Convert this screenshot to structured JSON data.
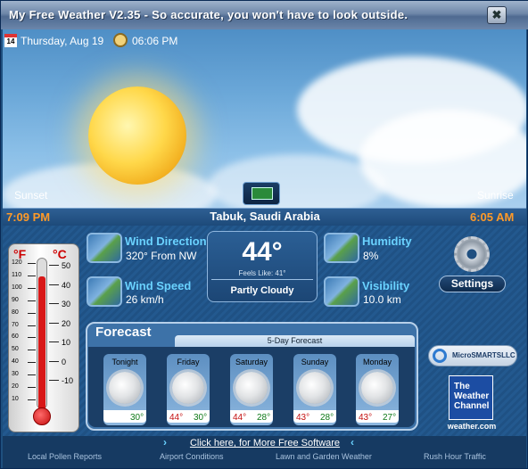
{
  "window": {
    "title": "My Free Weather V2.35 -  So accurate, you won't have to look outside.",
    "close_glyph": "✖"
  },
  "header": {
    "calendar_day": "14",
    "date": "Thursday, Aug 19",
    "time": "06:06 PM",
    "sunset_label": "Sunset",
    "sunrise_label": "Sunrise",
    "sunset_time": "7:09 PM",
    "sunrise_time": "6:05 AM",
    "location": "Tabuk, Saudi Arabia"
  },
  "thermometer": {
    "f_label": "°F",
    "c_label": "°C",
    "f_ticks": [
      "120",
      "110",
      "100",
      "90",
      "80",
      "70",
      "60",
      "50",
      "40",
      "30",
      "20",
      "10"
    ],
    "c_ticks": [
      "50",
      "40",
      "30",
      "20",
      "10",
      "0",
      "-10"
    ],
    "current_c": 44
  },
  "conditions": {
    "wind_direction_label": "Wind Direction",
    "wind_direction_value": "320° From NW",
    "wind_speed_label": "Wind Speed",
    "wind_speed_value": "26 km/h",
    "humidity_label": "Humidity",
    "humidity_value": "8%",
    "visibility_label": "Visibility",
    "visibility_value": "10.0 km",
    "temperature": "44°",
    "feels_like": "Feels Like: 41°",
    "condition": "Partly Cloudy"
  },
  "settings": {
    "label": "Settings"
  },
  "forecast": {
    "title": "Forecast",
    "subtitle": "5-Day Forecast",
    "days": [
      {
        "name": "Tonight",
        "hi": "",
        "lo": "30°"
      },
      {
        "name": "Friday",
        "hi": "44°",
        "lo": "30°"
      },
      {
        "name": "Saturday",
        "hi": "44°",
        "lo": "28°"
      },
      {
        "name": "Sunday",
        "hi": "43°",
        "lo": "28°"
      },
      {
        "name": "Monday",
        "hi": "43°",
        "lo": "27°"
      }
    ]
  },
  "logos": {
    "microsmarts": "MicroSMARTSLLC",
    "twc_line1": "The",
    "twc_line2": "Weather",
    "twc_line3": "Channel",
    "twc_url": "weather.com"
  },
  "footer": {
    "more_software": "Click here, for More Free Software",
    "arrow_left": "›",
    "arrow_right": "‹",
    "links": [
      "Local Pollen Reports",
      "Airport Conditions",
      "Lawn and Garden Weather",
      "Rush Hour Traffic"
    ]
  }
}
